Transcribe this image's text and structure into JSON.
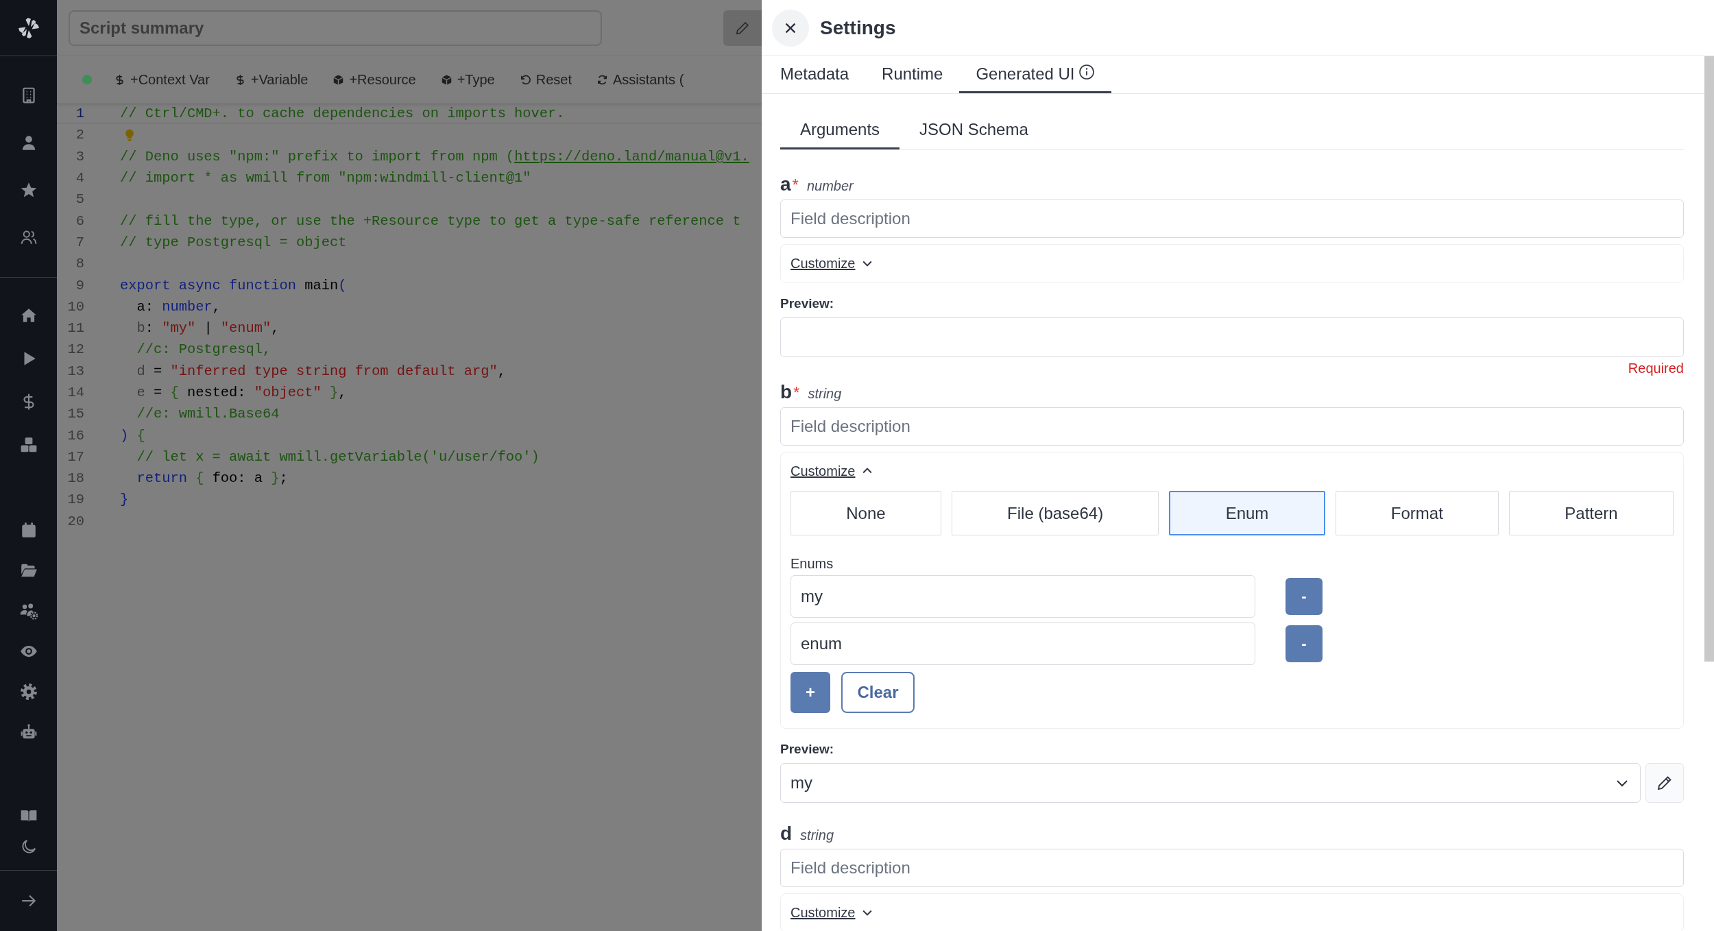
{
  "header": {
    "summary_placeholder": "Script summary"
  },
  "toolbar": {
    "items": [
      {
        "label": "+Context Var"
      },
      {
        "label": "+Variable"
      },
      {
        "label": "+Resource"
      },
      {
        "label": "+Type"
      },
      {
        "label": "Reset"
      },
      {
        "label": "Assistants ("
      }
    ]
  },
  "editor": {
    "lines": [
      {
        "number": "1",
        "selected": true,
        "tokens": [
          {
            "kind": "comment",
            "text": "// Ctrl/CMD+. to cache dependencies on imports hover."
          }
        ]
      },
      {
        "number": "2",
        "selected": false,
        "tokens": [
          {
            "kind": "lightbulb"
          }
        ]
      },
      {
        "number": "3",
        "selected": false,
        "tokens": [
          {
            "kind": "comment",
            "text": "// Deno uses \"npm:\" prefix to import from npm ("
          },
          {
            "kind": "link",
            "text": "https://deno.land/manual@v1."
          }
        ]
      },
      {
        "number": "4",
        "selected": false,
        "tokens": [
          {
            "kind": "comment",
            "text": "// import * as wmill from \"npm:windmill-client@1\""
          }
        ]
      },
      {
        "number": "5",
        "selected": false
      },
      {
        "number": "6",
        "selected": false,
        "tokens": [
          {
            "kind": "comment",
            "text": "// fill the type, or use the +Resource type to get a type-safe reference t"
          }
        ]
      },
      {
        "number": "7",
        "selected": false,
        "tokens": [
          {
            "kind": "comment",
            "text": "// type Postgresql = object"
          }
        ]
      },
      {
        "number": "8",
        "selected": false
      },
      {
        "number": "9",
        "selected": false,
        "tokens": [
          {
            "kind": "keyword",
            "text": "export async function "
          },
          {
            "kind": "plain",
            "text": "main"
          },
          {
            "kind": "bracket",
            "text": "("
          }
        ]
      },
      {
        "number": "10",
        "selected": false,
        "tokens": [
          {
            "kind": "plain",
            "text": "  a: "
          },
          {
            "kind": "keyword",
            "text": "number"
          },
          {
            "kind": "plain",
            "text": ","
          }
        ]
      },
      {
        "number": "11",
        "selected": false,
        "tokens": [
          {
            "kind": "muted",
            "text": "  b"
          },
          {
            "kind": "plain",
            "text": ": "
          },
          {
            "kind": "string",
            "text": "\"my\""
          },
          {
            "kind": "plain",
            "text": " | "
          },
          {
            "kind": "string",
            "text": "\"enum\""
          },
          {
            "kind": "plain",
            "text": ","
          }
        ]
      },
      {
        "number": "12",
        "selected": false,
        "tokens": [
          {
            "kind": "comment",
            "text": "  //c: Postgresql,"
          }
        ]
      },
      {
        "number": "13",
        "selected": false,
        "tokens": [
          {
            "kind": "muted",
            "text": "  d"
          },
          {
            "kind": "plain",
            "text": " = "
          },
          {
            "kind": "string",
            "text": "\"inferred type string from default arg\""
          },
          {
            "kind": "plain",
            "text": ","
          }
        ]
      },
      {
        "number": "14",
        "selected": false,
        "tokens": [
          {
            "kind": "muted",
            "text": "  e"
          },
          {
            "kind": "plain",
            "text": " = "
          },
          {
            "kind": "bracket2",
            "text": "{"
          },
          {
            "kind": "plain",
            "text": " nested: "
          },
          {
            "kind": "string",
            "text": "\"object\""
          },
          {
            "kind": "bracket2",
            "text": " }"
          },
          {
            "kind": "plain",
            "text": ","
          }
        ]
      },
      {
        "number": "15",
        "selected": false,
        "tokens": [
          {
            "kind": "comment",
            "text": "  //e: wmill.Base64"
          }
        ]
      },
      {
        "number": "16",
        "selected": false,
        "tokens": [
          {
            "kind": "bracket",
            "text": ")"
          },
          {
            "kind": "bracket2",
            "text": " {"
          }
        ]
      },
      {
        "number": "17",
        "selected": false,
        "tokens": [
          {
            "kind": "comment",
            "text": "  // let x = await wmill.getVariable('u/user/foo')"
          }
        ]
      },
      {
        "number": "18",
        "selected": false,
        "tokens": [
          {
            "kind": "keyword",
            "text": "  return"
          },
          {
            "kind": "bracket2",
            "text": " {"
          },
          {
            "kind": "plain",
            "text": " foo: a "
          },
          {
            "kind": "bracket2",
            "text": "}"
          },
          {
            "kind": "plain",
            "text": ";"
          }
        ]
      },
      {
        "number": "19",
        "selected": false,
        "tokens": [
          {
            "kind": "bracket",
            "text": "}"
          }
        ]
      },
      {
        "number": "20",
        "selected": false
      }
    ]
  },
  "settings": {
    "title": "Settings",
    "tabs": [
      {
        "label": "Metadata",
        "selected": false,
        "info": false
      },
      {
        "label": "Runtime",
        "selected": false,
        "info": false
      },
      {
        "label": "Generated UI",
        "selected": true,
        "info": true
      }
    ],
    "subtabs": [
      {
        "label": "Arguments",
        "selected": true
      },
      {
        "label": "JSON Schema",
        "selected": false
      }
    ],
    "arguments": [
      {
        "name": "a",
        "required_mark": "*",
        "type": "number",
        "description_placeholder": "Field description",
        "customize": {
          "label": "Customize",
          "expanded": false
        },
        "preview": {
          "label": "Preview:",
          "kind": "input",
          "error": "Required"
        }
      },
      {
        "name": "b",
        "required_mark": "*",
        "type": "string",
        "description_placeholder": "Field description",
        "customize": {
          "label": "Customize",
          "expanded": true,
          "options": [
            {
              "label": "None",
              "selected": false
            },
            {
              "label": "File (base64)",
              "selected": false
            },
            {
              "label": "Enum",
              "selected": true
            },
            {
              "label": "Format",
              "selected": false
            },
            {
              "label": "Pattern",
              "selected": false
            }
          ],
          "enums_label": "Enums",
          "enums": [
            {
              "value": "my",
              "remove": "-"
            },
            {
              "value": "enum",
              "remove": "-"
            }
          ],
          "add": "+",
          "clear": "Clear"
        },
        "preview": {
          "label": "Preview:",
          "kind": "select",
          "value": "my"
        }
      },
      {
        "name": "d",
        "type": "string",
        "description_placeholder": "Field description",
        "customize": {
          "label": "Customize",
          "expanded": false
        }
      }
    ]
  }
}
